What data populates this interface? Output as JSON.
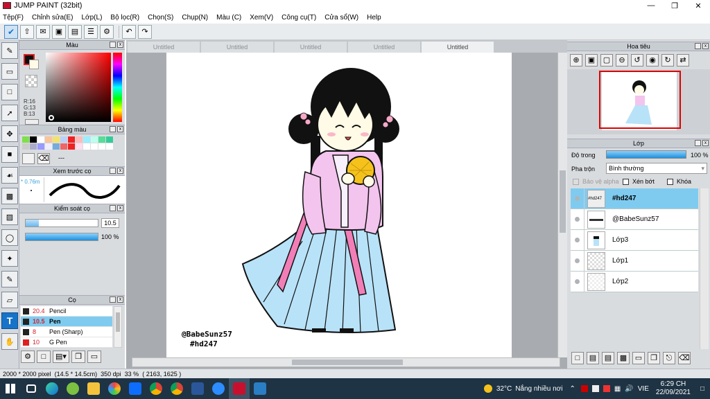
{
  "window": {
    "title": "JUMP PAINT (32bit)"
  },
  "menu": [
    "Tệp(F)",
    "Chỉnh sửa(E)",
    "Lớp(L)",
    "Bộ lọc(R)",
    "Chọn(S)",
    "Chụp(N)",
    "Màu (C)",
    "Xem(V)",
    "Công cụ(T)",
    "Cửa sổ(W)",
    "Help"
  ],
  "doc_tabs": [
    "Untitled",
    "Untitled",
    "Untitled",
    "Untitled",
    "Untitled"
  ],
  "color_panel": {
    "title": "Màu",
    "r": "R:16",
    "g": "G:13",
    "b": "B:13"
  },
  "palette_panel": {
    "title": "Bảng màu",
    "more": "---"
  },
  "brush_preview": {
    "title": "Xem trước cọ",
    "size": "0.76m"
  },
  "brush_control": {
    "title": "Kiểm soát cọ",
    "size_value": "10.5",
    "opacity_value": "100 %",
    "size_fraction": 0.18,
    "opacity_fraction": 1.0
  },
  "brush_panel": {
    "title": "Cọ",
    "items": [
      {
        "size": "20.4",
        "name": "Pencil",
        "color": "#222222",
        "selected": false
      },
      {
        "size": "10.5",
        "name": "Pen",
        "color": "#222222",
        "selected": true
      },
      {
        "size": "8",
        "name": "Pen (Sharp)",
        "color": "#222222",
        "selected": false
      },
      {
        "size": "10",
        "name": "G Pen",
        "color": "#e02020",
        "selected": false
      }
    ]
  },
  "artwork": {
    "signature": "@BabeSunz57",
    "tag": "#hd247"
  },
  "navigator": {
    "title": "Hoa tiêu"
  },
  "layer_panel": {
    "title": "Lớp",
    "opacity_label": "Độ trong",
    "opacity_value": "100 %",
    "opacity_fraction": 1.0,
    "blend_label": "Pha trộn",
    "blend_value": "Bình thường",
    "protect_alpha": "Bảo vệ alpha",
    "clip": "Xén bớt",
    "lock": "Khóa",
    "layers": [
      {
        "name": "#hd247",
        "selected": true
      },
      {
        "name": "@BabeSunz57",
        "selected": false
      },
      {
        "name": "Lớp3",
        "selected": false
      },
      {
        "name": "Lớp1",
        "selected": false
      },
      {
        "name": "Lớp2",
        "selected": false
      }
    ]
  },
  "status": {
    "size": "2000 * 2000 pixel",
    "dimensions": "(14.5 * 14.5cm)",
    "dpi": "350 dpi",
    "zoom": "33 %",
    "coords": "( 2163, 1625 )"
  },
  "taskbar": {
    "weather_temp": "32°C",
    "weather_text": "Nắng nhiều nơi",
    "lang": "VIE",
    "time": "6:29 CH",
    "date": "22/09/2021"
  },
  "colors": {
    "accent": "#1673c9",
    "selected_layer": "#7fcbf0",
    "skirt": "#b8e2f8",
    "jacket": "#f3c4ee",
    "ribbon": "#f27eb8",
    "fan": "#f5c21c"
  }
}
